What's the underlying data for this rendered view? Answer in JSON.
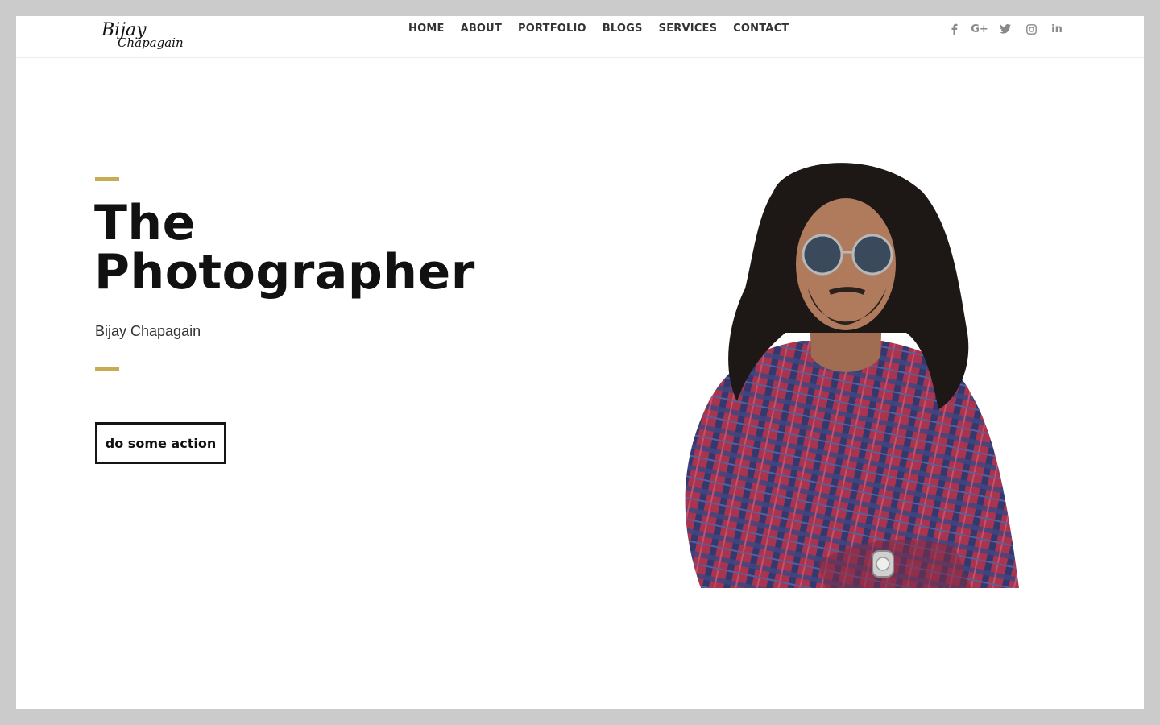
{
  "logo": {
    "line1": "Bijay",
    "line2": "Chapagain"
  },
  "nav": {
    "items": [
      {
        "label": "HOME"
      },
      {
        "label": "ABOUT"
      },
      {
        "label": "PORTFOLIO"
      },
      {
        "label": "BLOGS"
      },
      {
        "label": "SERVICES"
      },
      {
        "label": "CONTACT"
      }
    ]
  },
  "social": {
    "icons": [
      "facebook-icon",
      "google-plus-icon",
      "twitter-icon",
      "instagram-icon",
      "linkedin-icon"
    ],
    "google_plus_text": "G+",
    "linkedin_text": "in"
  },
  "hero": {
    "title_line1": "The",
    "title_line2": "Photographer",
    "subtitle": "Bijay Chapagain",
    "cta_label": "do some action"
  },
  "colors": {
    "accent": "#c9ac52",
    "text": "#111111",
    "page_bg": "#ffffff",
    "frame_bg": "#cbcbcb",
    "social_icon": "#8a8a8a"
  }
}
